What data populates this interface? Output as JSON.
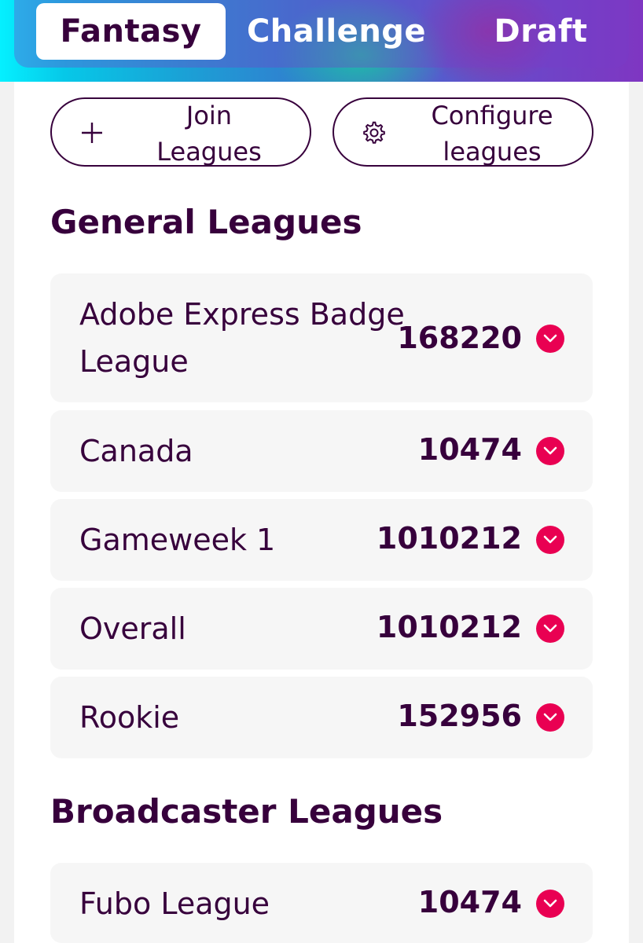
{
  "tabs": [
    {
      "label": "Fantasy",
      "active": true
    },
    {
      "label": "Challenge",
      "active": false
    },
    {
      "label": "Draft",
      "active": false
    }
  ],
  "actions": {
    "join_line1": "Join",
    "join_line2": "Leagues",
    "join_icon": "plus-icon",
    "configure_line1": "Configure",
    "configure_line2": "leagues",
    "configure_icon": "gear-icon"
  },
  "sections": {
    "general_title": "General Leagues",
    "broadcaster_title": "Broadcaster Leagues"
  },
  "general_leagues": [
    {
      "name_line1": "Adobe Express Badge",
      "name_line2": "League",
      "rank": "168220",
      "movement": "down"
    },
    {
      "name": "Canada",
      "rank": "10474",
      "movement": "down"
    },
    {
      "name": "Gameweek 1",
      "rank": "1010212",
      "movement": "down"
    },
    {
      "name": "Overall",
      "rank": "1010212",
      "movement": "down"
    },
    {
      "name": "Rookie",
      "rank": "152956",
      "movement": "down"
    }
  ],
  "broadcaster_leagues": [
    {
      "name": "Fubo League",
      "rank": "10474",
      "movement": "down"
    }
  ],
  "colors": {
    "primary": "#37003c",
    "down_badge": "#e90052",
    "row_bg": "#f6f6f6"
  }
}
